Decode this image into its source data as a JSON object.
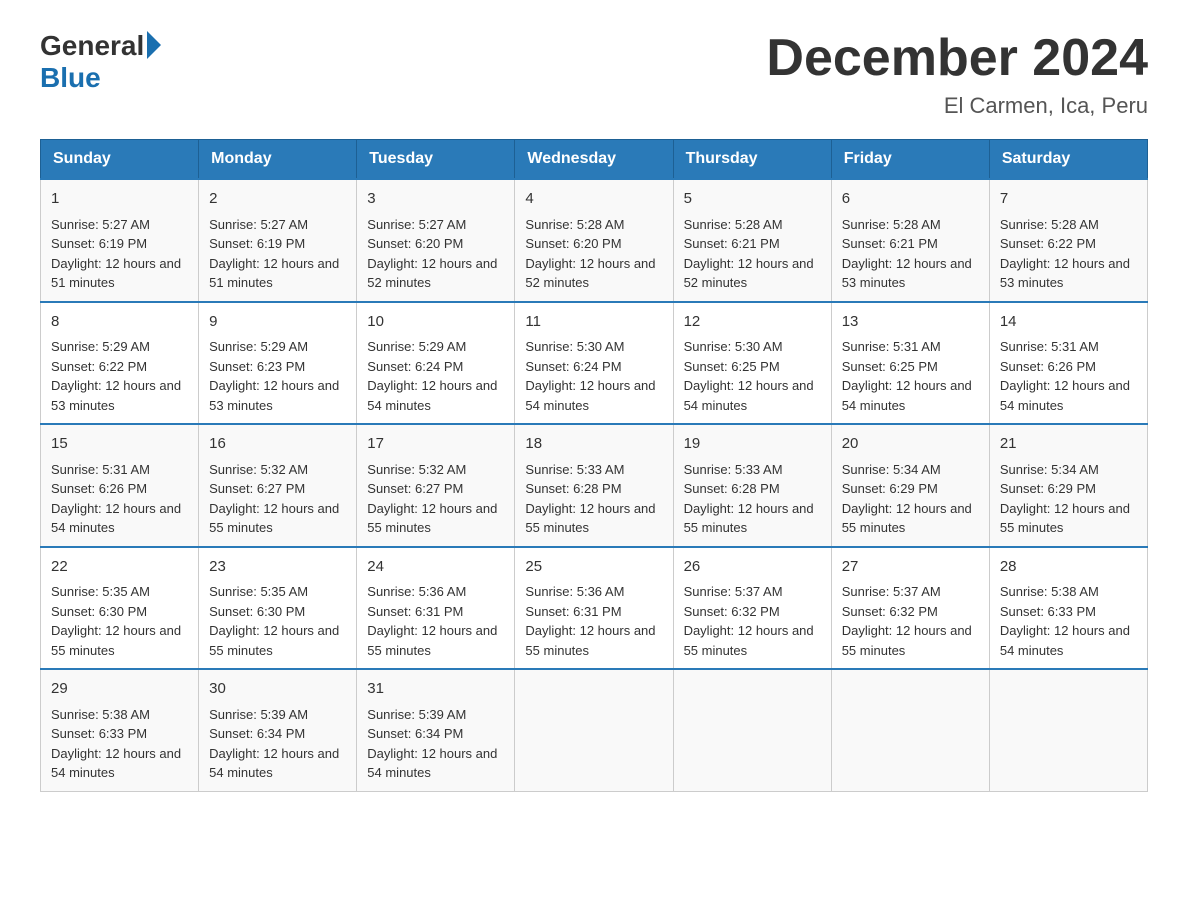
{
  "logo": {
    "general": "General",
    "blue": "Blue"
  },
  "title": "December 2024",
  "subtitle": "El Carmen, Ica, Peru",
  "days_of_week": [
    "Sunday",
    "Monday",
    "Tuesday",
    "Wednesday",
    "Thursday",
    "Friday",
    "Saturday"
  ],
  "weeks": [
    [
      {
        "day": "1",
        "sunrise": "5:27 AM",
        "sunset": "6:19 PM",
        "daylight": "12 hours and 51 minutes."
      },
      {
        "day": "2",
        "sunrise": "5:27 AM",
        "sunset": "6:19 PM",
        "daylight": "12 hours and 51 minutes."
      },
      {
        "day": "3",
        "sunrise": "5:27 AM",
        "sunset": "6:20 PM",
        "daylight": "12 hours and 52 minutes."
      },
      {
        "day": "4",
        "sunrise": "5:28 AM",
        "sunset": "6:20 PM",
        "daylight": "12 hours and 52 minutes."
      },
      {
        "day": "5",
        "sunrise": "5:28 AM",
        "sunset": "6:21 PM",
        "daylight": "12 hours and 52 minutes."
      },
      {
        "day": "6",
        "sunrise": "5:28 AM",
        "sunset": "6:21 PM",
        "daylight": "12 hours and 53 minutes."
      },
      {
        "day": "7",
        "sunrise": "5:28 AM",
        "sunset": "6:22 PM",
        "daylight": "12 hours and 53 minutes."
      }
    ],
    [
      {
        "day": "8",
        "sunrise": "5:29 AM",
        "sunset": "6:22 PM",
        "daylight": "12 hours and 53 minutes."
      },
      {
        "day": "9",
        "sunrise": "5:29 AM",
        "sunset": "6:23 PM",
        "daylight": "12 hours and 53 minutes."
      },
      {
        "day": "10",
        "sunrise": "5:29 AM",
        "sunset": "6:24 PM",
        "daylight": "12 hours and 54 minutes."
      },
      {
        "day": "11",
        "sunrise": "5:30 AM",
        "sunset": "6:24 PM",
        "daylight": "12 hours and 54 minutes."
      },
      {
        "day": "12",
        "sunrise": "5:30 AM",
        "sunset": "6:25 PM",
        "daylight": "12 hours and 54 minutes."
      },
      {
        "day": "13",
        "sunrise": "5:31 AM",
        "sunset": "6:25 PM",
        "daylight": "12 hours and 54 minutes."
      },
      {
        "day": "14",
        "sunrise": "5:31 AM",
        "sunset": "6:26 PM",
        "daylight": "12 hours and 54 minutes."
      }
    ],
    [
      {
        "day": "15",
        "sunrise": "5:31 AM",
        "sunset": "6:26 PM",
        "daylight": "12 hours and 54 minutes."
      },
      {
        "day": "16",
        "sunrise": "5:32 AM",
        "sunset": "6:27 PM",
        "daylight": "12 hours and 55 minutes."
      },
      {
        "day": "17",
        "sunrise": "5:32 AM",
        "sunset": "6:27 PM",
        "daylight": "12 hours and 55 minutes."
      },
      {
        "day": "18",
        "sunrise": "5:33 AM",
        "sunset": "6:28 PM",
        "daylight": "12 hours and 55 minutes."
      },
      {
        "day": "19",
        "sunrise": "5:33 AM",
        "sunset": "6:28 PM",
        "daylight": "12 hours and 55 minutes."
      },
      {
        "day": "20",
        "sunrise": "5:34 AM",
        "sunset": "6:29 PM",
        "daylight": "12 hours and 55 minutes."
      },
      {
        "day": "21",
        "sunrise": "5:34 AM",
        "sunset": "6:29 PM",
        "daylight": "12 hours and 55 minutes."
      }
    ],
    [
      {
        "day": "22",
        "sunrise": "5:35 AM",
        "sunset": "6:30 PM",
        "daylight": "12 hours and 55 minutes."
      },
      {
        "day": "23",
        "sunrise": "5:35 AM",
        "sunset": "6:30 PM",
        "daylight": "12 hours and 55 minutes."
      },
      {
        "day": "24",
        "sunrise": "5:36 AM",
        "sunset": "6:31 PM",
        "daylight": "12 hours and 55 minutes."
      },
      {
        "day": "25",
        "sunrise": "5:36 AM",
        "sunset": "6:31 PM",
        "daylight": "12 hours and 55 minutes."
      },
      {
        "day": "26",
        "sunrise": "5:37 AM",
        "sunset": "6:32 PM",
        "daylight": "12 hours and 55 minutes."
      },
      {
        "day": "27",
        "sunrise": "5:37 AM",
        "sunset": "6:32 PM",
        "daylight": "12 hours and 55 minutes."
      },
      {
        "day": "28",
        "sunrise": "5:38 AM",
        "sunset": "6:33 PM",
        "daylight": "12 hours and 54 minutes."
      }
    ],
    [
      {
        "day": "29",
        "sunrise": "5:38 AM",
        "sunset": "6:33 PM",
        "daylight": "12 hours and 54 minutes."
      },
      {
        "day": "30",
        "sunrise": "5:39 AM",
        "sunset": "6:34 PM",
        "daylight": "12 hours and 54 minutes."
      },
      {
        "day": "31",
        "sunrise": "5:39 AM",
        "sunset": "6:34 PM",
        "daylight": "12 hours and 54 minutes."
      },
      null,
      null,
      null,
      null
    ]
  ]
}
